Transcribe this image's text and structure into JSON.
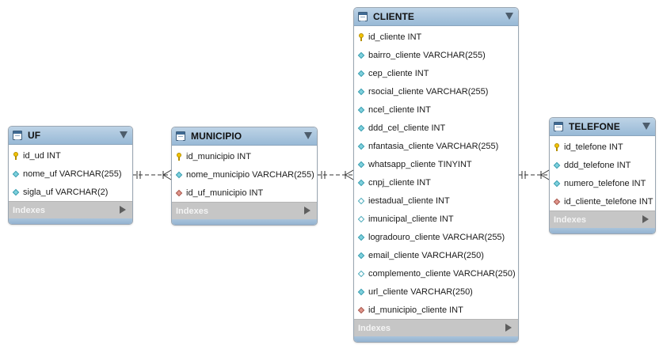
{
  "tables": [
    {
      "name": "UF",
      "columns": [
        {
          "text": "id_ud INT",
          "kind": "key"
        },
        {
          "text": "nome_uf VARCHAR(255)",
          "kind": "attr"
        },
        {
          "text": "sigla_uf VARCHAR(2)",
          "kind": "attr"
        }
      ],
      "indexes_label": "Indexes"
    },
    {
      "name": "MUNICIPIO",
      "columns": [
        {
          "text": "id_municipio INT",
          "kind": "key"
        },
        {
          "text": "nome_municipio VARCHAR(255)",
          "kind": "attr"
        },
        {
          "text": "id_uf_municipio INT",
          "kind": "fk"
        }
      ],
      "indexes_label": "Indexes"
    },
    {
      "name": "CLIENTE",
      "columns": [
        {
          "text": "id_cliente INT",
          "kind": "key"
        },
        {
          "text": "bairro_cliente VARCHAR(255)",
          "kind": "attr"
        },
        {
          "text": "cep_cliente INT",
          "kind": "attr"
        },
        {
          "text": "rsocial_cliente VARCHAR(255)",
          "kind": "attr"
        },
        {
          "text": "ncel_cliente INT",
          "kind": "attr"
        },
        {
          "text": "ddd_cel_cliente INT",
          "kind": "attr"
        },
        {
          "text": "nfantasia_cliente VARCHAR(255)",
          "kind": "attr"
        },
        {
          "text": "whatsapp_cliente TINYINT",
          "kind": "attr"
        },
        {
          "text": "cnpj_cliente INT",
          "kind": "attr"
        },
        {
          "text": "iestadual_cliente INT",
          "kind": "hollow"
        },
        {
          "text": "imunicipal_cliente INT",
          "kind": "hollow"
        },
        {
          "text": "logradouro_cliente VARCHAR(255)",
          "kind": "attr"
        },
        {
          "text": "email_cliente VARCHAR(250)",
          "kind": "attr"
        },
        {
          "text": "complemento_cliente VARCHAR(250)",
          "kind": "hollow"
        },
        {
          "text": "url_cliente VARCHAR(250)",
          "kind": "attr"
        },
        {
          "text": "id_municipio_cliente INT",
          "kind": "fk"
        }
      ],
      "indexes_label": "Indexes"
    },
    {
      "name": "TELEFONE",
      "columns": [
        {
          "text": "id_telefone INT",
          "kind": "key"
        },
        {
          "text": "ddd_telefone INT",
          "kind": "attr"
        },
        {
          "text": "numero_telefone INT",
          "kind": "attr"
        },
        {
          "text": "id_cliente_telefone INT",
          "kind": "fk"
        }
      ],
      "indexes_label": "Indexes"
    }
  ],
  "relationships": [
    {
      "from": "UF",
      "to": "MUNICIPIO",
      "from_end": "one-and-only-one",
      "to_end": "one-or-many",
      "line": "dashed"
    },
    {
      "from": "MUNICIPIO",
      "to": "CLIENTE",
      "from_end": "one-and-only-one",
      "to_end": "one-or-many",
      "line": "dashed"
    },
    {
      "from": "CLIENTE",
      "to": "TELEFONE",
      "from_end": "one-and-only-one",
      "to_end": "one-or-many",
      "line": "dashed"
    }
  ],
  "colors": {
    "header": "#a9c3db",
    "indexes_bar": "#c6c6c6",
    "key_icon": "#f3c300",
    "attribute_icon": "#7ed1dd",
    "foreign_key_icon": "#e0948a"
  }
}
